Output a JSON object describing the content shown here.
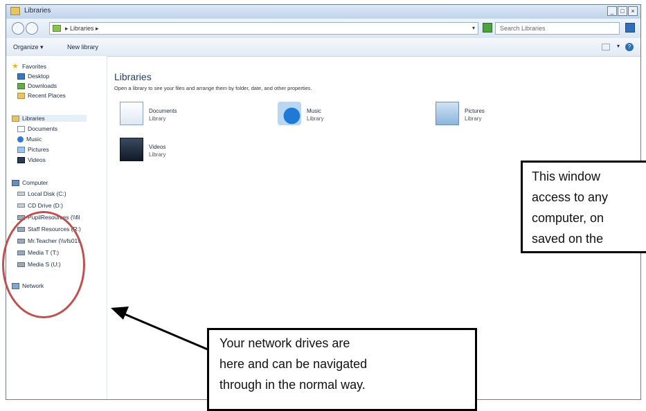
{
  "window": {
    "title": "Libraries",
    "buttons": [
      "_",
      "□",
      "×"
    ]
  },
  "address": {
    "crumb": "▸ Libraries ▸",
    "search_placeholder": "Search Libraries"
  },
  "toolbar": {
    "organize": "Organize ▾",
    "new_library": "New library"
  },
  "nav": {
    "favorites": "Favorites",
    "desktop": "Desktop",
    "downloads": "Downloads",
    "recent": "Recent Places",
    "libraries": "Libraries",
    "documents": "Documents",
    "music": "Music",
    "pictures": "Pictures",
    "videos": "Videos",
    "computer": "Computer",
    "local_disk": "Local Disk (C:)",
    "cd_drive": "CD Drive (D:)",
    "pupil": "PupilResources (\\\\fil",
    "staff": "Staff Resources (R:)",
    "mrteacher": "Mr.Teacher (\\\\vfs01\\",
    "mediat": "Media T (T:)",
    "medias": "Media S (U:)",
    "network": "Network"
  },
  "content": {
    "title": "Libraries",
    "description": "Open a library to see your files and arrange them by folder, date, and other properties.",
    "libraries": [
      {
        "name": "Documents",
        "type": "Library"
      },
      {
        "name": "Music",
        "type": "Library"
      },
      {
        "name": "Pictures",
        "type": "Library"
      },
      {
        "name": "Videos",
        "type": "Library"
      }
    ]
  },
  "callouts": {
    "right": [
      "This window",
      "access to any",
      "computer, on",
      "saved on the"
    ],
    "bottom": [
      "Your network drives are",
      "here and can be navigated",
      "through in the normal way."
    ]
  },
  "colors": {
    "annotation_circle": "#c0504d",
    "accent": "#1e3f66"
  }
}
